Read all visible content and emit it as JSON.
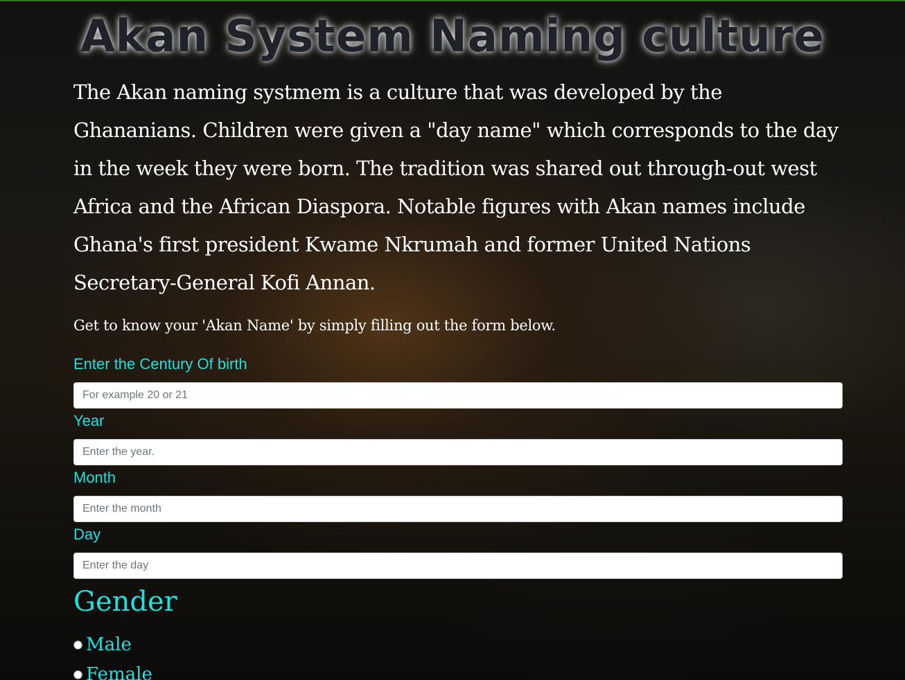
{
  "header": {
    "title": "Akan System Naming culture"
  },
  "intro": {
    "text": "The Akan naming systmem is a culture that was developed by the Ghananians. Children were given a \"day name\" which corresponds to the day in the week they were born. The tradition was shared out through-out west Africa and the African Diaspora. Notable figures with Akan names include Ghana's first president Kwame Nkrumah and former United Nations Secretary-General Kofi Annan.",
    "cta": "Get to know your 'Akan Name' by simply filling out the form below."
  },
  "form": {
    "century": {
      "label": "Enter the Century Of birth",
      "placeholder": "For example 20 or 21",
      "value": ""
    },
    "year": {
      "label": "Year",
      "placeholder": "Enter the year.",
      "value": ""
    },
    "month": {
      "label": "Month",
      "placeholder": "Enter the month",
      "value": ""
    },
    "day": {
      "label": "Day",
      "placeholder": "Enter the day",
      "value": ""
    },
    "gender": {
      "title": "Gender",
      "options": [
        {
          "label": "Male",
          "selected": false
        },
        {
          "label": "Female",
          "selected": false
        }
      ]
    }
  },
  "colors": {
    "accent": "#1fe0e0",
    "title_text": "#1f2228",
    "body_text": "#ffffff",
    "top_border": "#2f7a2a"
  }
}
